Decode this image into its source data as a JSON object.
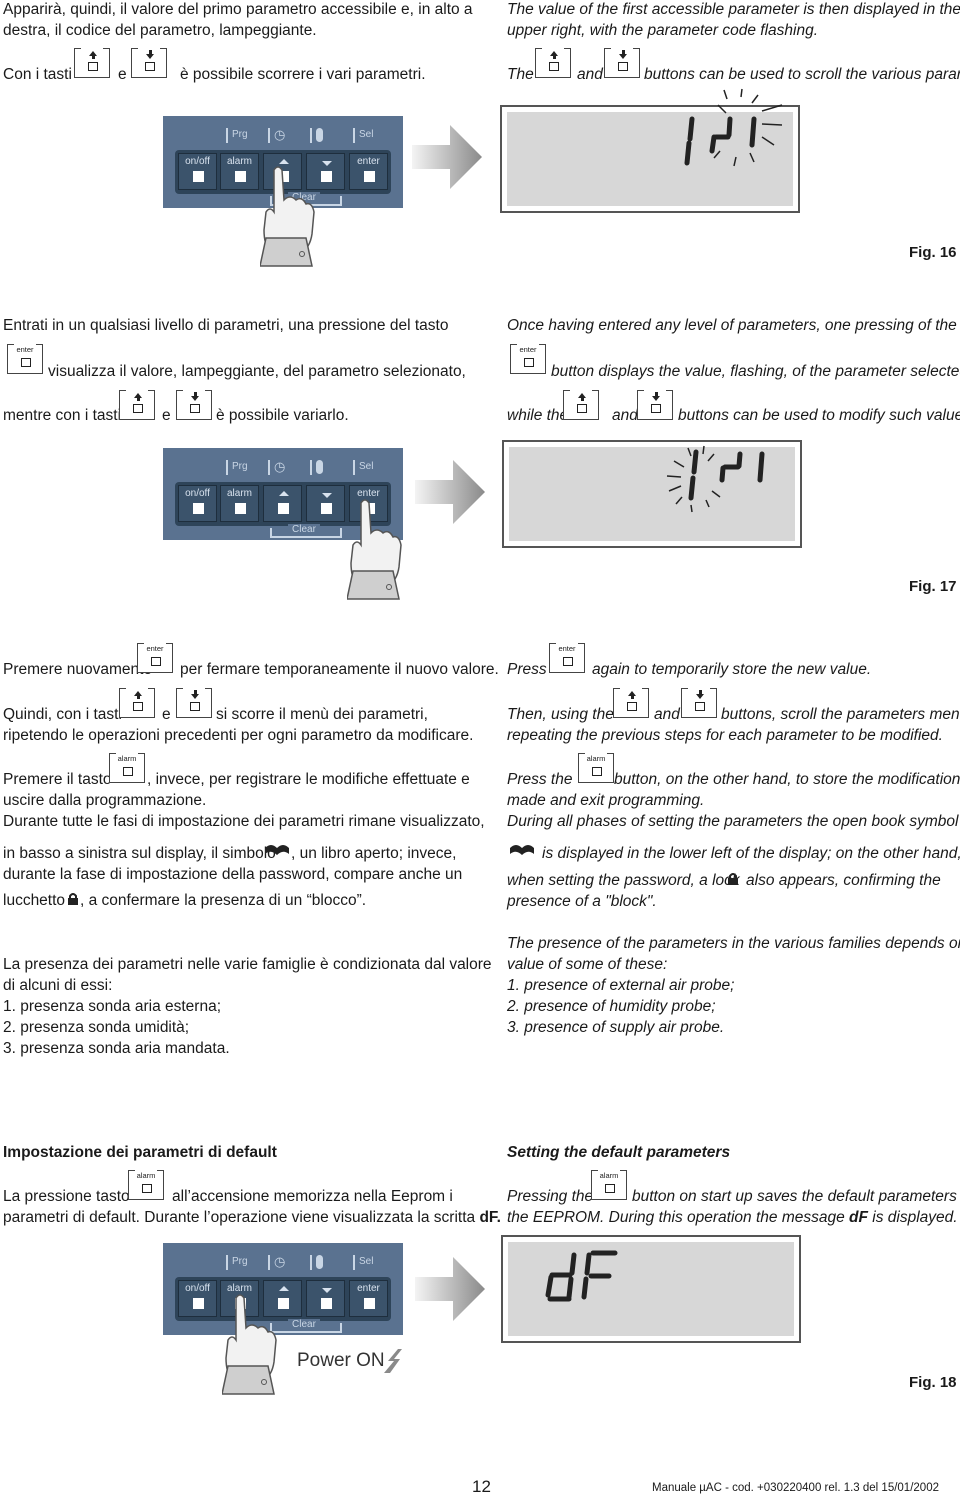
{
  "section1": {
    "it": {
      "line1": "Apparirà, quindi, il valore del primo parametro accessibile e, in alto a",
      "line2": "destra, il codice del parametro, lampeggiante.",
      "line3_a": "Con i tasti",
      "line3_b": "e",
      "line3_c": "è possibile scorrere i vari parametri."
    },
    "en": {
      "line1": "The value of the first accessible parameter is then displayed in the",
      "line2": "upper right, with the parameter code flashing.",
      "line3_a": "The",
      "line3_b": "and",
      "line3_c": "buttons can be used to scroll the various parameters."
    },
    "lcd_text": "1r1",
    "pressed_button": "up",
    "figure": "Fig. 16"
  },
  "section2": {
    "it": {
      "line1": "Entrati in un qualsiasi livello di parametri, una pressione del tasto",
      "line2": "visualizza il valore, lampeggiante, del parametro selezionato,",
      "line3_a": "mentre con i tasti",
      "line3_b": "e",
      "line3_c": "è possibile variarlo."
    },
    "en": {
      "line1": "Once having entered any level of parameters, one pressing of the",
      "line2": "button displays the value, flashing, of the parameter selected,",
      "line3_a": "while the",
      "line3_b": "and",
      "line3_c": "buttons can be used to modify such value."
    },
    "lcd_text": "1r1",
    "pressed_button": "enter",
    "figure": "Fig. 17"
  },
  "section3": {
    "it": {
      "p1_a": "Premere nuovamente",
      "p1_b": "per fermare temporaneamente il nuovo valore.",
      "p2_a": "Quindi, con i tasti",
      "p2_b": "e",
      "p2_c": "si scorre il menù dei parametri,",
      "p2_d": "ripetendo le operazioni precedenti per ogni parametro da modificare.",
      "p3_a": "Premere il tasto",
      "p3_b": ", invece, per registrare le modifiche effettuate e",
      "p3_c": "uscire dalla programmazione.",
      "p3_d": "Durante tutte le fasi di impostazione dei parametri rimane visualizzato,",
      "p3_e": "in basso a sinistra sul display, il simbolo",
      "p3_f": ", un libro aperto; invece,",
      "p3_g": "durante la fase di impostazione della password, compare anche un",
      "p3_h": "lucchetto",
      "p3_i": ", a confermare la presenza di un “blocco”.",
      "p4_a": "La presenza dei parametri nelle varie famiglie è condizionata dal valore",
      "p4_b": "di alcuni di essi:",
      "list": [
        "1. presenza sonda aria esterna;",
        "2. presenza sonda umidità;",
        "3. presenza sonda aria mandata."
      ]
    },
    "en": {
      "p1_a": "Press",
      "p1_b": "again to temporarily store the new value.",
      "p2_a": "Then, using the",
      "p2_b": "and",
      "p2_c": "buttons, scroll the parameters menu,",
      "p2_d": "repeating the previous steps for each parameter to be modified.",
      "p3_a": "Press the",
      "p3_b": "button, on the other hand, to store the modifications",
      "p3_c": "made and exit programming.",
      "p3_d": "During all phases of setting the parameters the open book symbol",
      "p3_e": "is displayed in the lower left of the display; on the other hand,",
      "p3_f": "when setting the password, a lock",
      "p3_g": "also appears, confirming the",
      "p3_h": "presence of a \"block\".",
      "p4_a": "The presence of the parameters in the various families depends on the",
      "p4_b": "value of some of these:",
      "list": [
        "1. presence of external air probe;",
        "2. presence of humidity probe;",
        "3. presence of supply air probe."
      ]
    }
  },
  "section4": {
    "it": {
      "title": "Impostazione dei parametri di default",
      "l1_a": "La pressione tasto",
      "l1_b": "all’accensione memorizza nella Eeprom i",
      "l2_a": "parametri di default. Durante l’operazione viene visualizzata la scritta",
      "l2_b": "dF."
    },
    "en": {
      "title": "Setting the default parameters",
      "l1_a": "Pressing the",
      "l1_b": "button on start up saves the default parameters in",
      "l2_a": "the EEPROM. During this operation the message",
      "l2_b": "dF",
      "l2_c": "is displayed."
    },
    "power_on": "Power ON",
    "lcd_text": "dF",
    "pressed_button": "alarm",
    "figure": "Fig. 18"
  },
  "panel": {
    "top_labels": [
      "Prg",
      "clock",
      "thermometer",
      "Sel"
    ],
    "buttons": [
      "on/off",
      "alarm",
      "up",
      "down",
      "enter"
    ],
    "clear_label": "Clear"
  },
  "keys": {
    "enter": "enter",
    "alarm": "alarm"
  },
  "footer": {
    "page_number": "12",
    "doc_ref": "Manuale µAC - cod. +030220400 rel. 1.3 del 15/01/2002"
  },
  "colors": {
    "panel": "#5a7290",
    "strip": "#2e4459",
    "lcd": "#d7d7d7"
  }
}
